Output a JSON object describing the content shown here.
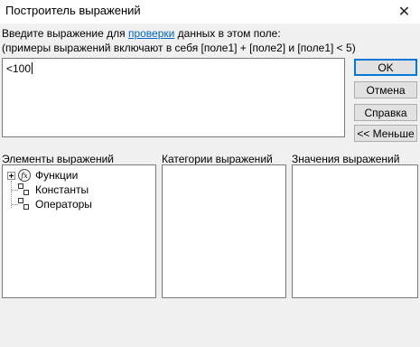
{
  "window": {
    "title": "Построитель выражений",
    "close_glyph": "✕"
  },
  "instructions": {
    "line1_prefix": "Введите выражение для ",
    "line1_link": "проверки",
    "line1_suffix": " данных в этом поле:",
    "line2": "(примеры выражений включают в себя [поле1] + [поле2] и [поле1] < 5)"
  },
  "expression": {
    "value": "<100"
  },
  "buttons": {
    "ok": "OK",
    "cancel": "Отмена",
    "help": "Справка",
    "less": "<< Меньше"
  },
  "panels": {
    "elements_label": "Элементы выражений",
    "categories_label": "Категории выражений",
    "values_label": "Значения выражений",
    "tree": [
      {
        "label": "Функции",
        "icon": "function-icon"
      },
      {
        "label": "Константы",
        "icon": "constants-icon"
      },
      {
        "label": "Операторы",
        "icon": "operators-icon"
      }
    ]
  }
}
